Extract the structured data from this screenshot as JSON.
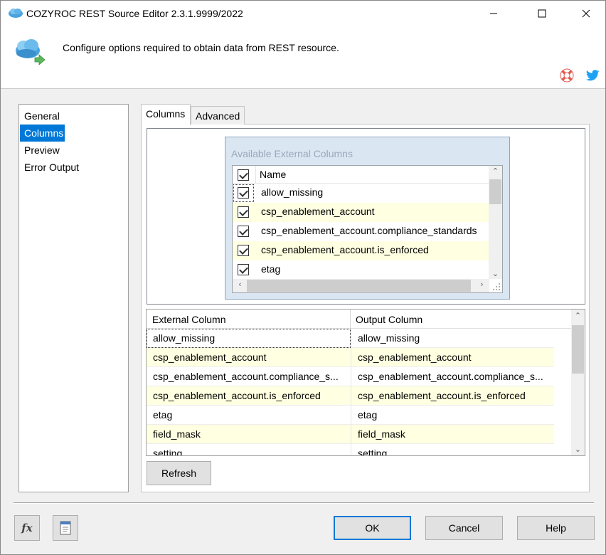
{
  "window": {
    "title": "COZYROC REST Source Editor 2.3.1.9999/2022",
    "header_text": "Configure options required to obtain data from REST resource."
  },
  "nav": {
    "items": [
      {
        "label": "General"
      },
      {
        "label": "Columns"
      },
      {
        "label": "Preview"
      },
      {
        "label": "Error Output"
      }
    ],
    "selected": "Columns"
  },
  "tabs": [
    {
      "label": "Columns"
    },
    {
      "label": "Advanced"
    }
  ],
  "available": {
    "title": "Available External Columns",
    "header": "Name",
    "items": [
      {
        "label": "allow_missing",
        "checked": true
      },
      {
        "label": "csp_enablement_account",
        "checked": true
      },
      {
        "label": "csp_enablement_account.compliance_standards",
        "checked": true
      },
      {
        "label": "csp_enablement_account.is_enforced",
        "checked": true
      },
      {
        "label": "etag",
        "checked": true
      }
    ]
  },
  "mapping": {
    "columns": [
      "External Column",
      "Output Column"
    ],
    "rows": [
      {
        "external": "allow_missing",
        "output": "allow_missing"
      },
      {
        "external": "csp_enablement_account",
        "output": "csp_enablement_account"
      },
      {
        "external": "csp_enablement_account.compliance_s...",
        "output": "csp_enablement_account.compliance_s..."
      },
      {
        "external": "csp_enablement_account.is_enforced",
        "output": "csp_enablement_account.is_enforced"
      },
      {
        "external": "etag",
        "output": "etag"
      },
      {
        "external": "field_mask",
        "output": "field_mask"
      },
      {
        "external": "setting",
        "output": "setting"
      }
    ]
  },
  "buttons": {
    "refresh": "Refresh",
    "ok": "OK",
    "cancel": "Cancel",
    "help": "Help"
  },
  "colors": {
    "accent": "#0078d7",
    "alt_row": "#ffffe1"
  }
}
